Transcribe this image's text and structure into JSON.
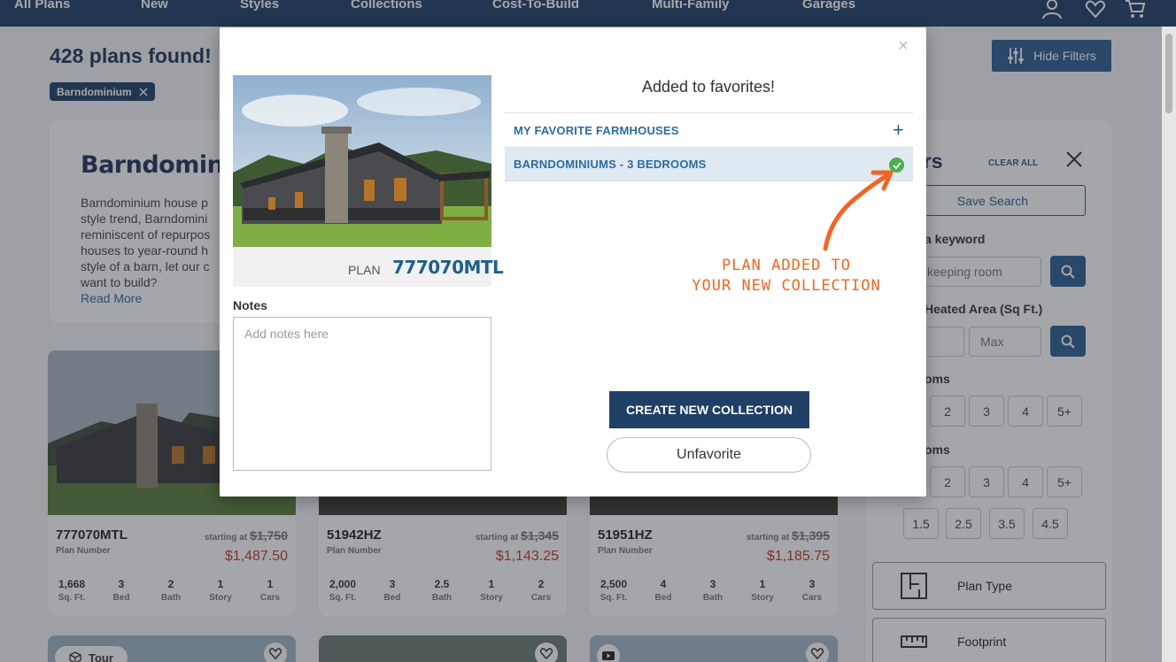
{
  "nav": {
    "items": [
      "All Plans",
      "New",
      "Styles",
      "Collections",
      "Cost-To-Build",
      "Multi-Family",
      "Garages"
    ],
    "icons": [
      "user-icon",
      "heart-icon",
      "cart-icon"
    ]
  },
  "results": {
    "count_text": "428 plans found!",
    "active_filter": "Barndominium",
    "hide_filters_label": "Hide Filters"
  },
  "intro": {
    "title": "Barndominium",
    "lines": [
      "Barndominium house p",
      "style trend, Barndomini",
      "reminiscent of repurpos",
      "houses to year-round h",
      "style of a barn, let our c",
      "want to build?"
    ],
    "read_more": "Read More"
  },
  "filters": {
    "title": "ers",
    "clear_all": "CLEAR ALL",
    "save_search": "Save Search",
    "keyword_label": "a keyword",
    "keyword_placeholder": "keeping room",
    "heated_label": "Heated Area (Sq Ft.)",
    "max_placeholder": "Max",
    "bedrooms_label": "oms",
    "bedrooms_options": [
      "2",
      "3",
      "4",
      "5+"
    ],
    "bathrooms_label": "oms",
    "bathrooms_options": [
      "2",
      "3",
      "4",
      "5+"
    ],
    "half_bath_options": [
      "1.5",
      "2.5",
      "3.5",
      "4.5"
    ],
    "plan_type_label": "Plan Type",
    "footprint_label": "Footprint"
  },
  "plan_cards": [
    {
      "number": "777070MTL",
      "sub": "Plan Number",
      "starting": "starting at",
      "old_price": "$1,750",
      "price": "$1,487.50",
      "stats": [
        {
          "v": "1,668",
          "l": "Sq. Ft."
        },
        {
          "v": "3",
          "l": "Bed"
        },
        {
          "v": "2",
          "l": "Bath"
        },
        {
          "v": "1",
          "l": "Story"
        },
        {
          "v": "1",
          "l": "Cars"
        }
      ]
    },
    {
      "number": "51942HZ",
      "sub": "Plan Number",
      "starting": "starting at",
      "old_price": "$1,345",
      "price": "$1,143.25",
      "stats": [
        {
          "v": "2,000",
          "l": "Sq. Ft."
        },
        {
          "v": "3",
          "l": "Bed"
        },
        {
          "v": "2.5",
          "l": "Bath"
        },
        {
          "v": "1",
          "l": "Story"
        },
        {
          "v": "2",
          "l": "Cars"
        }
      ]
    },
    {
      "number": "51951HZ",
      "sub": "Plan Number",
      "starting": "starting at",
      "old_price": "$1,395",
      "price": "$1,185.75",
      "stats": [
        {
          "v": "2,500",
          "l": "Sq. Ft."
        },
        {
          "v": "4",
          "l": "Bed"
        },
        {
          "v": "3",
          "l": "Bath"
        },
        {
          "v": "1",
          "l": "Story"
        },
        {
          "v": "3",
          "l": "Cars"
        }
      ]
    }
  ],
  "row2": {
    "tour_label": "Tour"
  },
  "modal": {
    "plan_label": "PLAN",
    "plan_number": "777070MTL",
    "notes_label": "Notes",
    "notes_placeholder": "Add notes here",
    "added_title": "Added to favorites!",
    "collections": [
      {
        "name": "MY FAVORITE FARMHOUSES",
        "selected": false
      },
      {
        "name": "BARNDOMINIUMS - 3 BEDROOMS",
        "selected": true
      }
    ],
    "annotation_line1": "PLAN ADDED TO",
    "annotation_line2": "YOUR NEW COLLECTION",
    "create_button": "CREATE NEW COLLECTION",
    "unfavorite_button": "Unfavorite",
    "close_symbol": "×"
  },
  "colors": {
    "nav_bg": "#1f3f66",
    "accent": "#2b5d8f",
    "price_red": "#c0392b",
    "annotation_orange": "#f26522",
    "check_green": "#4caf50"
  }
}
